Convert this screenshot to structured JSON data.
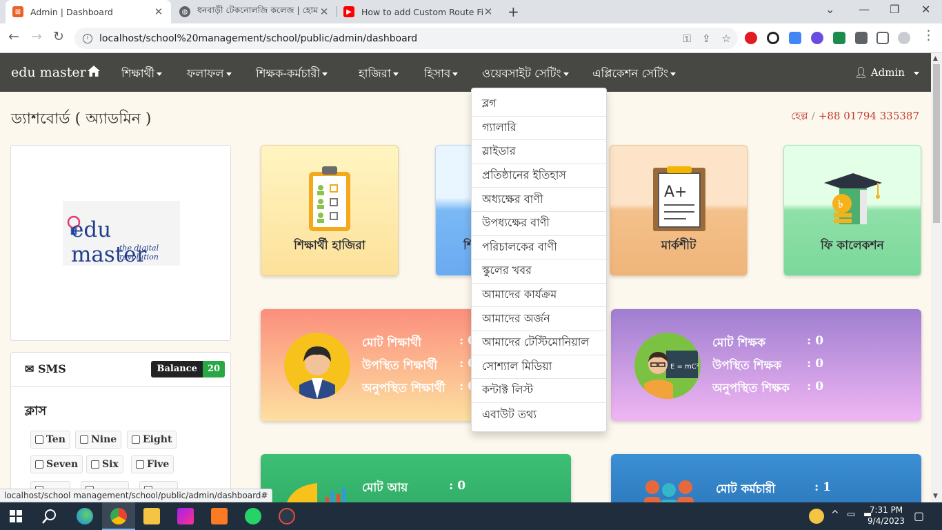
{
  "browser": {
    "tabs": [
      {
        "title": "Admin | Dashboard",
        "active": true
      },
      {
        "title": "ধনবাড়ী টেকনোলজি কলেজ | হোম",
        "active": false
      },
      {
        "title": "How to add Custom Route File In",
        "active": false
      }
    ],
    "url": "localhost/school%20management/school/public/admin/dashboard",
    "status_url": "localhost/school management/school/public/admin/dashboard#"
  },
  "navbar": {
    "brand": "edu master",
    "items": [
      "শিক্ষার্থী",
      "ফলাফল",
      "শিক্ষক-কর্মচারী",
      "হাজিরা",
      "হিসাব",
      "ওয়েবসাইট সেটিং",
      "এপ্লিকেশন সেটিং"
    ],
    "user": "Admin"
  },
  "dropdown": {
    "items": [
      "ব্লগ",
      "গ্যালারি",
      "স্লাইডার",
      "প্রতিষ্ঠানের ইতিহাস",
      "অধ্যক্ষের বাণী",
      "উপধ্যক্ষের বাণী",
      "পরিচালকের বাণী",
      "স্কুলের খবর",
      "আমাদের কার্যক্রম",
      "আমাদের অর্জন",
      "আমাদের টেস্টিমোনিয়াল",
      "সোশ্যাল মিডিয়া",
      "কন্টাক্ট লিস্ট",
      "এবাউট তথ্য"
    ]
  },
  "page": {
    "title": "ড্যাশবোর্ড ( অ্যাডমিন )",
    "help_label": "হেল্প",
    "phone": "+88 01794 335387"
  },
  "logo": {
    "name": "edu master",
    "tagline": "the digital revolution"
  },
  "sms": {
    "label": "SMS",
    "balance_label": "Balance",
    "balance_value": "20",
    "class_label": "ক্লাস",
    "classes": [
      "Ten",
      "Nine",
      "Eight",
      "Seven",
      "Six",
      "Five"
    ]
  },
  "tiles": [
    {
      "label": "শিক্ষার্থী হাজিরা",
      "icon": "attendance-clipboard-icon"
    },
    {
      "label": "শি",
      "icon": "partial-hidden"
    },
    {
      "label": "মার্কশীট",
      "icon": "marksheet-icon"
    },
    {
      "label": "ফি কালেকশন",
      "icon": "fee-collection-icon"
    }
  ],
  "stats": {
    "students": {
      "rows": [
        {
          "label": "মোট শিক্ষার্থী",
          "value": ": 0"
        },
        {
          "label": "উপস্থিত শিক্ষার্থী",
          "value": ": 0"
        },
        {
          "label": "অনুপস্থিত শিক্ষার্থী",
          "value": ": 0"
        }
      ]
    },
    "teachers": {
      "rows": [
        {
          "label": "মোট শিক্ষক",
          "value": ": 0"
        },
        {
          "label": "উপস্থিত শিক্ষক",
          "value": ": 0"
        },
        {
          "label": "অনুপস্থিত শিক্ষক",
          "value": ": 0"
        }
      ]
    },
    "income": {
      "label": "মোট আয়",
      "value": ": 0"
    },
    "staff": {
      "label": "মোট কর্মচারী",
      "value": ": 1"
    }
  },
  "taskbar": {
    "time": "7:31 PM",
    "date": "9/4/2023"
  }
}
